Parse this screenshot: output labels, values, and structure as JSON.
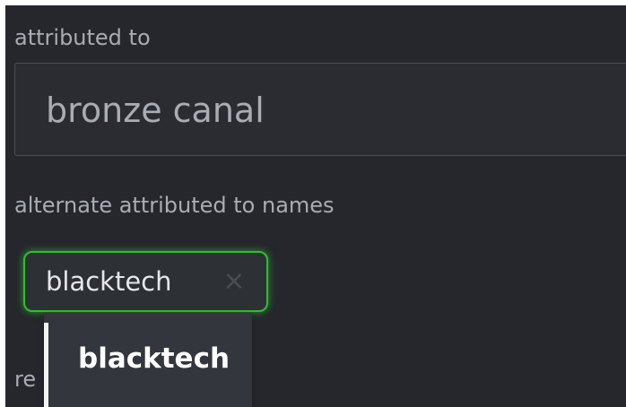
{
  "form": {
    "attributed_to": {
      "label": "attributed to",
      "value": "bronze canal"
    },
    "alternate_names": {
      "label": "alternate attributed to names",
      "chips": [
        {
          "text": "blacktech",
          "remove_symbol": "×"
        }
      ],
      "suggestions": [
        {
          "text": "blacktech"
        }
      ]
    },
    "next_field_label_partial": "re"
  },
  "colors": {
    "background": "#25272c",
    "chip_focus_border": "#2fbf2f",
    "dropdown_background": "#33363c"
  },
  "icons": {
    "chip_remove": "close-icon"
  }
}
